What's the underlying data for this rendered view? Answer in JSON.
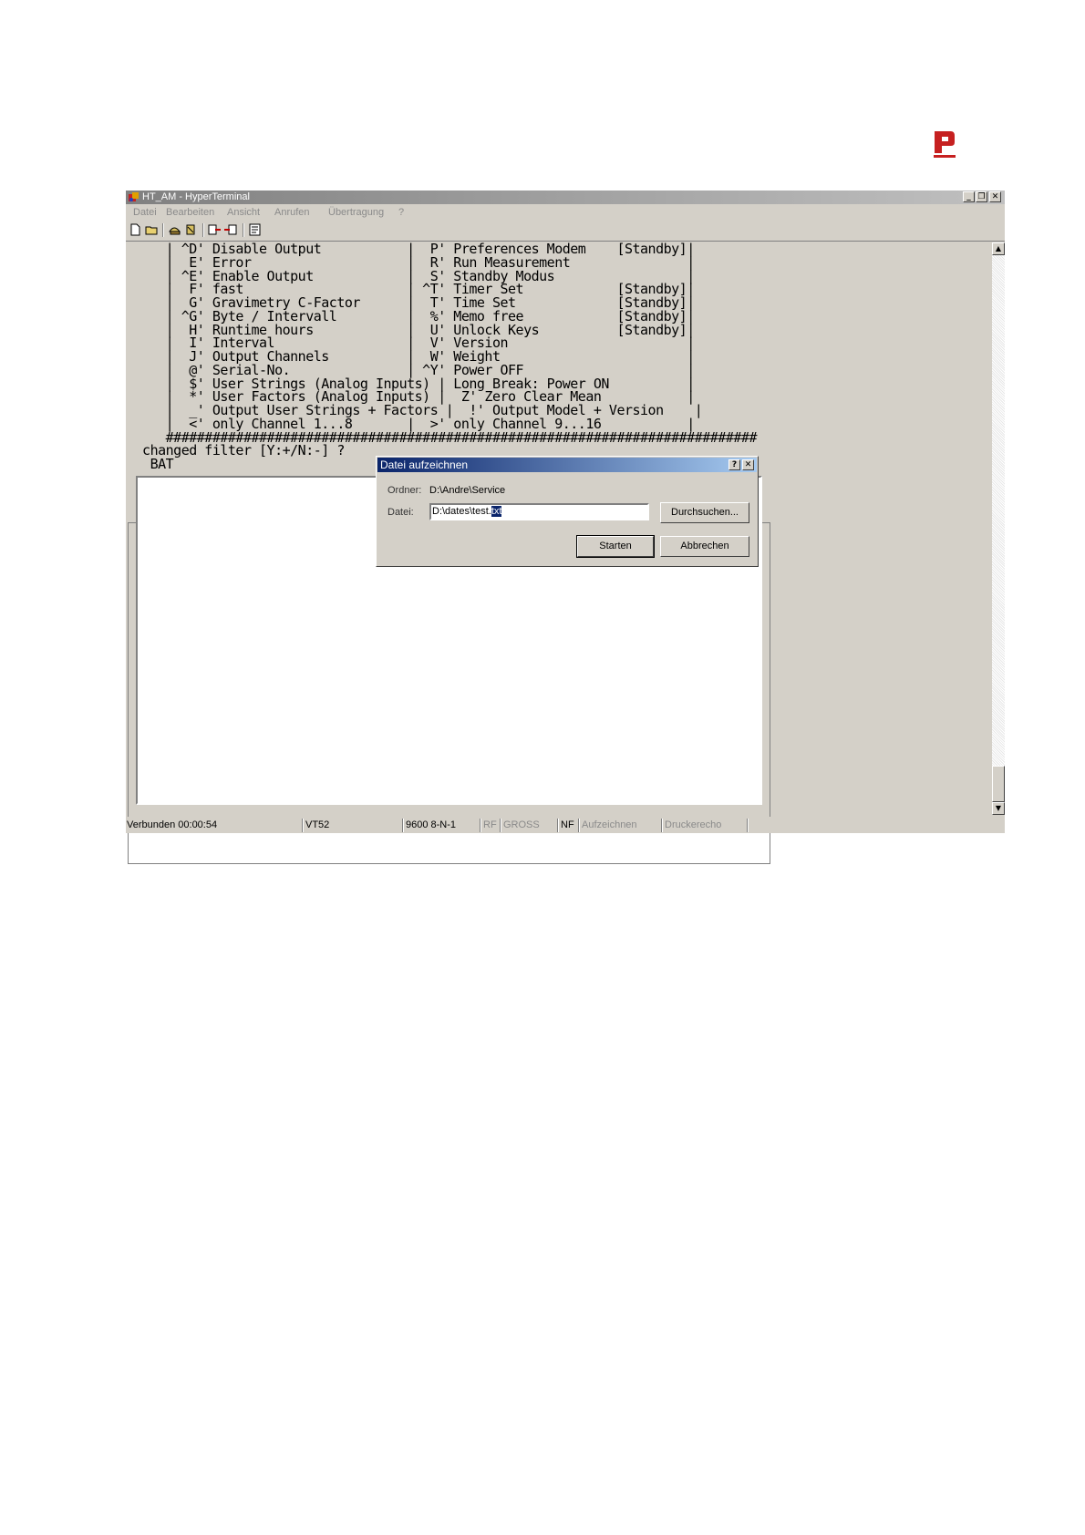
{
  "window": {
    "title": "HT_AM - HyperTerminal",
    "controls": [
      "_",
      "❐",
      "✕"
    ]
  },
  "menu": {
    "items": [
      "Datei",
      "Bearbeiten",
      "Ansicht",
      "Anrufen",
      "Übertragung",
      "?"
    ]
  },
  "toolbar": {
    "icons": [
      "new-icon",
      "open-icon",
      "connect-icon",
      "disconnect-icon",
      "send-icon",
      "receive-icon",
      "properties-icon"
    ]
  },
  "terminal": {
    "lines": [
      "     | ^D' Disable Output           |  P' Preferences Modem    [Standby]|",
      "     |  E' Error                    |  R' Run Measurement               |",
      "     | ^E' Enable Output            |  S' Standby Modus                 |",
      "     |  F' fast                     | ^T' Timer Set            [Standby]|",
      "     |  G' Gravimetry C-Factor      |  T' Time Set             [Standby]|",
      "     | ^G' Byte / Intervall         |  %' Memo free            [Standby]|",
      "     |  H' Runtime hours            |  U' Unlock Keys          [Standby]|",
      "     |  I' Interval                 |  V' Version                       |",
      "     |  J' Output Channels          |  W' Weight                        |",
      "     |  @' Serial-No.               | ^Y' Power OFF                     |",
      "     |  $' User Strings (Analog Inputs) | Long Break: Power ON          |",
      "     |  *' User Factors (Analog Inputs) |  Z' Zero Clear Mean           |",
      "     |  _' Output User Strings + Factors |  !' Output Model + Version    |",
      "     |  <' only Channel 1...8       |  >' only Channel 9...16           |",
      "     ############################################################################",
      "  changed filter [Y:+/N:-] ?",
      "   BAT"
    ]
  },
  "dialog": {
    "title": "Datei aufzeichnen",
    "help_button": "?",
    "close_button": "✕",
    "folder_label": "Ordner:",
    "folder_value": "D:\\Andre\\Service",
    "file_label": "Datei:",
    "file_value_prefix": "D:\\dates\\test.",
    "file_value_selected": "txt",
    "browse_button": "Durchsuchen...",
    "start_button": "Starten",
    "cancel_button": "Abbrechen"
  },
  "statusbar": {
    "connected": "Verbunden 00:00:54",
    "emulation": "VT52",
    "port_settings": "9600 8-N-1",
    "rf": "RF",
    "caps": "GROSS",
    "nf": "NF",
    "capture": "Aufzeichnen",
    "print_echo": "Druckerecho"
  },
  "colors": {
    "dialog_title_start": "#0a246a",
    "dialog_title_end": "#a6caf0",
    "logo_red": "#c62020"
  }
}
